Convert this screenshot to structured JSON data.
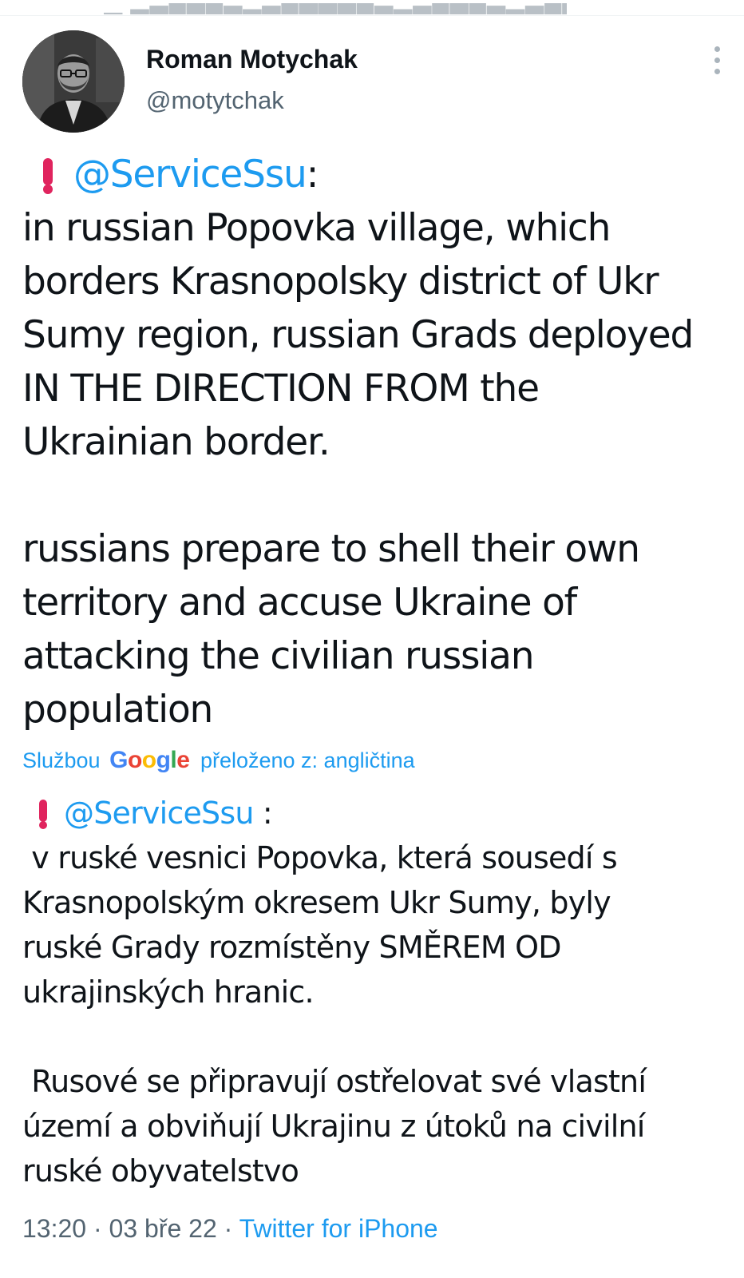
{
  "tweet": {
    "author": {
      "display_name": "Roman Motychak",
      "handle": "@motytchak"
    },
    "icons": {
      "more": "more-vertical-icon",
      "alert": "red-exclamation-icon"
    },
    "colors": {
      "link": "#1d9bf0",
      "secondary_text": "#536471",
      "alert_red": "#e0245e"
    },
    "original": {
      "mention": "@ServiceSsu",
      "mention_suffix": ":",
      "lines_p1": [
        "in russian Popovka village, which",
        "borders Krasnopolsky district of Ukr",
        "Sumy region, russian Grads deployed",
        "IN THE DIRECTION FROM the",
        "Ukrainian border."
      ],
      "lines_p2": [
        "russians prepare to shell their own",
        "territory and accuse Ukraine of",
        "attacking the civilian russian",
        "population"
      ]
    },
    "translation": {
      "prefix": "Službou",
      "brand": "Google",
      "suffix": "přeloženo z: angličtina",
      "mention": "@ServiceSsu",
      "mention_suffix": " :",
      "lines_p1": [
        " v ruské vesnici Popovka, která sousedí s",
        "Krasnopolským okresem Ukr Sumy, byly",
        "ruské Grady rozmístěny SMĚREM OD",
        "ukrajinských hranic."
      ],
      "lines_p2": [
        " Rusové se připravují ostřelovat své vlastní",
        "území a obviňují Ukrajinu z útoků na civilní",
        "ruské obyvatelstvo"
      ]
    },
    "meta": {
      "time": "13:20",
      "separator": " · ",
      "date": "03 bře 22",
      "source": "Twitter for iPhone"
    }
  }
}
